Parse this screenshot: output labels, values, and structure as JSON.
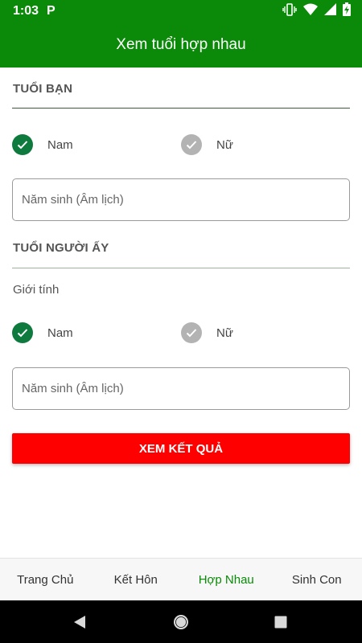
{
  "status_bar": {
    "time": "1:03",
    "notification_icon": "P"
  },
  "app_bar": {
    "title": "Xem tuổi hợp nhau"
  },
  "your_age": {
    "heading": "TUỔI BẠN",
    "options": [
      {
        "label": "Nam",
        "selected": true
      },
      {
        "label": "Nữ",
        "selected": false
      }
    ],
    "year_placeholder": "Năm sinh (Âm lịch)"
  },
  "partner_age": {
    "heading": "TUỔI NGƯỜI ẤY",
    "gender_label": "Giới tính",
    "options": [
      {
        "label": "Nam",
        "selected": true
      },
      {
        "label": "Nữ",
        "selected": false
      }
    ],
    "year_placeholder": "Năm sinh (Âm lịch)"
  },
  "submit_label": "XEM KẾT QUẢ",
  "bottom_nav": {
    "tabs": [
      {
        "label": "Trang Chủ",
        "active": false
      },
      {
        "label": "Kết Hôn",
        "active": false
      },
      {
        "label": "Hợp Nhau",
        "active": true
      },
      {
        "label": "Sinh Con",
        "active": false
      }
    ]
  },
  "colors": {
    "primary": "#0a8a08",
    "radio_checked": "#0f7a3e",
    "radio_unchecked": "#b3b3b3",
    "button": "#ff0000"
  }
}
